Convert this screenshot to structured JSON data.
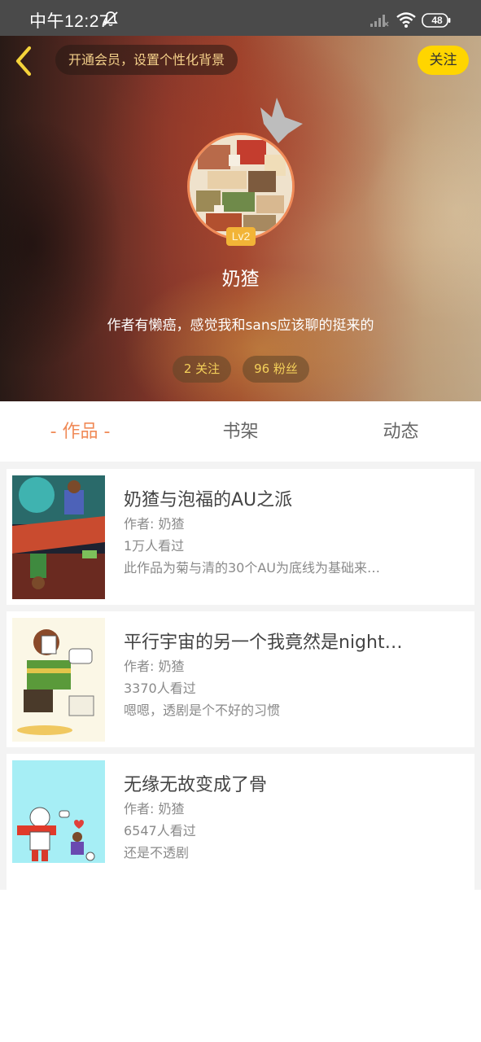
{
  "status_bar": {
    "time": "中午12:27",
    "battery": "48",
    "icons": [
      "bell-muted-icon",
      "signal-icon",
      "wifi-icon",
      "battery-icon"
    ]
  },
  "header": {
    "back_icon": "chevron-left-icon",
    "vip_banner": "开通会员，设置个性化背景",
    "follow_label": "关注",
    "accent_color": "#ffd500"
  },
  "profile": {
    "level": "Lv2",
    "username": "奶猹",
    "bio": "作者有懒癌，感觉我和sans应该聊的挺来的",
    "following": "2 关注",
    "fans": "96 粉丝"
  },
  "tabs": [
    {
      "label": "- 作品 -",
      "active": true
    },
    {
      "label": "书架",
      "active": false
    },
    {
      "label": "动态",
      "active": false
    }
  ],
  "active_tab_color": "#f08a57",
  "works": [
    {
      "title": "奶猹与泡福的AU之派",
      "author": "作者: 奶猹",
      "views": "1万人看过",
      "desc": "此作品为菊与清的30个AU为底线为基础来…"
    },
    {
      "title": "平行宇宙的另一个我竟然是night…",
      "author": "作者: 奶猹",
      "views": "3370人看过",
      "desc": "嗯嗯，透剧是个不好的习惯"
    },
    {
      "title": "无缘无故变成了骨",
      "author": "作者: 奶猹",
      "views": "6547人看过",
      "desc": "还是不透剧"
    }
  ]
}
